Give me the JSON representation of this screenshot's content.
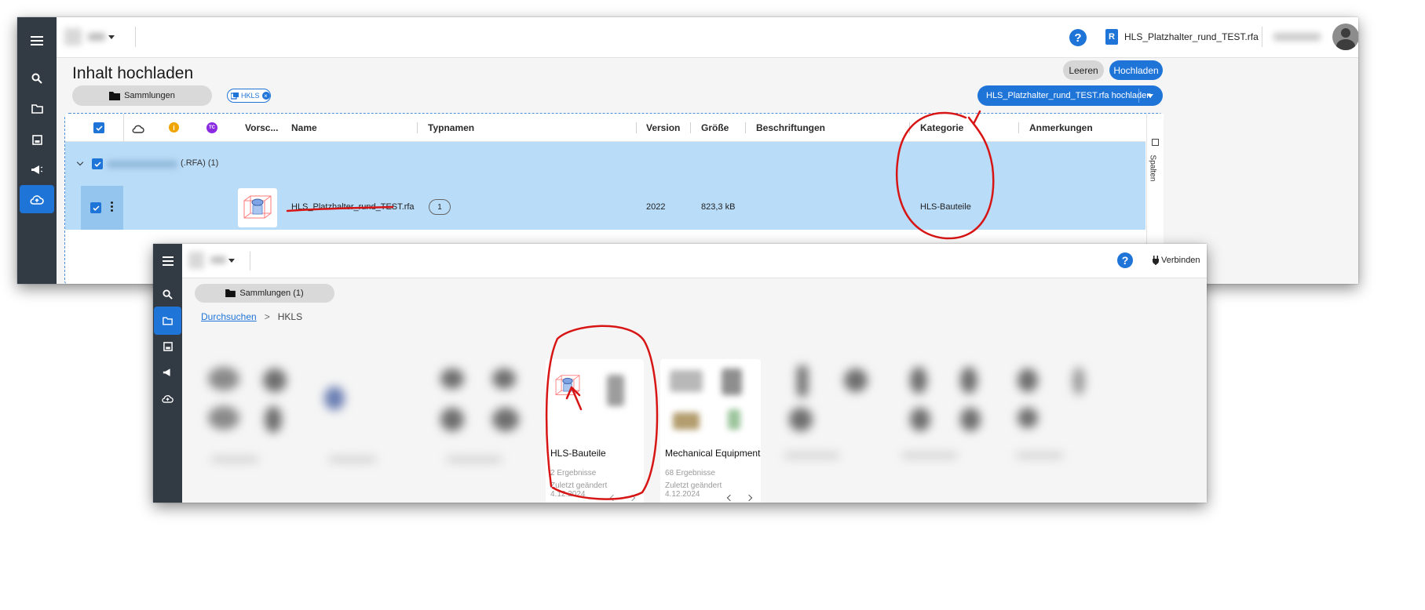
{
  "colors": {
    "accent": "#1f74d8",
    "rail": "#323a44",
    "selection": "#b9dcf8",
    "annotation": "#d81515"
  },
  "top": {
    "help_icon": "question-icon",
    "file_name": "HLS_Platzhalter_rund_TEST.rfa",
    "page_title": "Inhalt hochladen",
    "clear_label": "Leeren",
    "upload_label": "Hochladen",
    "collections_label": "Sammlungen",
    "filter_chip": "HKLS",
    "upload_file_label": "HLS_Platzhalter_rund_TEST.rfa hochladen",
    "columns_label": "Spalten",
    "table": {
      "headers": {
        "tc_badge": "TC",
        "preview": "Vorsc...",
        "name": "Name",
        "typenames": "Typnamen",
        "version": "Version",
        "size": "Größe",
        "labels": "Beschriftungen",
        "category": "Kategorie",
        "notes": "Anmerkungen"
      },
      "group_label": "(.RFA) (1)",
      "row": {
        "name": "HLS_Platzhalter_rund_TEST.rfa",
        "typenames_count": "1",
        "version": "2022",
        "size": "823,3 kB",
        "category": "HLS-Bauteile"
      }
    }
  },
  "bottom": {
    "help_icon": "question-icon",
    "connect_label": "Verbinden",
    "collections_label": "Sammlungen (1)",
    "breadcrumb": {
      "root": "Durchsuchen",
      "separator": ">",
      "current": "HKLS"
    },
    "cards": [
      {
        "title": "HLS-Bauteile",
        "results": "2 Ergebnisse",
        "modified_label": "Zuletzt geändert",
        "modified_date": "4.12.2024"
      },
      {
        "title": "Mechanical Equipment",
        "results": "68 Ergebnisse",
        "modified_label": "Zuletzt geändert",
        "modified_date": "4.12.2024"
      }
    ]
  }
}
